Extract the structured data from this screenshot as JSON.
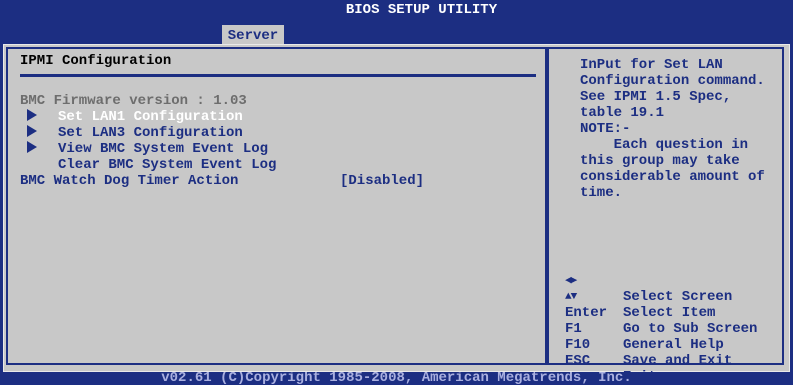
{
  "window": {
    "title": "BIOS SETUP UTILITY"
  },
  "tabs": [
    {
      "label": "Server",
      "active": true
    }
  ],
  "panel": {
    "title": "IPMI Configuration",
    "firmware": "BMC Firmware version : 1.03",
    "items": [
      {
        "label": "Set LAN1 Configuration",
        "submenu": true,
        "selected": true
      },
      {
        "label": "Set LAN3 Configuration",
        "submenu": true,
        "selected": false
      },
      {
        "label": "View BMC System Event Log",
        "submenu": true,
        "selected": false
      },
      {
        "label": "Clear BMC System Event Log",
        "submenu": false,
        "selected": false
      }
    ],
    "option": {
      "label": "BMC Watch Dog Timer Action",
      "value": "[Disabled]"
    }
  },
  "help": {
    "lines": [
      "InPut for Set LAN",
      "Configuration command.",
      "See IPMI 1.5 Spec,",
      "table 19.1",
      "NOTE:-",
      "    Each question in",
      "this group may take",
      "considerable amount of",
      "time."
    ]
  },
  "keys": [
    {
      "key_icon": "left-right-arrows-icon",
      "key": "",
      "desc": "Select Screen"
    },
    {
      "key_icon": "up-down-arrows-icon",
      "key": "",
      "desc": "Select Item"
    },
    {
      "key": "Enter",
      "desc": "Go to Sub Screen"
    },
    {
      "key": "F1",
      "desc": "General Help"
    },
    {
      "key": "F10",
      "desc": "Save and Exit"
    },
    {
      "key": "ESC",
      "desc": "Exit"
    }
  ],
  "footer": "v02.61 (C)Copyright 1985-2008, American Megatrends, Inc.",
  "colors": {
    "background": "#1c2e82",
    "panel": "#c8c8c8",
    "text_blue": "#1c2e82",
    "text_gray": "#6d6d6d",
    "highlight": "#ffffff"
  }
}
